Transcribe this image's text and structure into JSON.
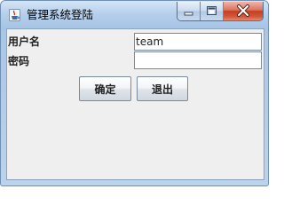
{
  "window": {
    "title": "管理系统登陆",
    "icon": "java-cup-icon"
  },
  "caption": {
    "minimize_icon": "minimize-icon",
    "maximize_icon": "maximize-icon",
    "close_icon": "close-icon",
    "close_color": "#c4401f"
  },
  "form": {
    "username_label": "用户名",
    "username_value": "team",
    "password_label": "密码",
    "password_value": ""
  },
  "buttons": {
    "ok_label": "确定",
    "exit_label": "退出"
  }
}
